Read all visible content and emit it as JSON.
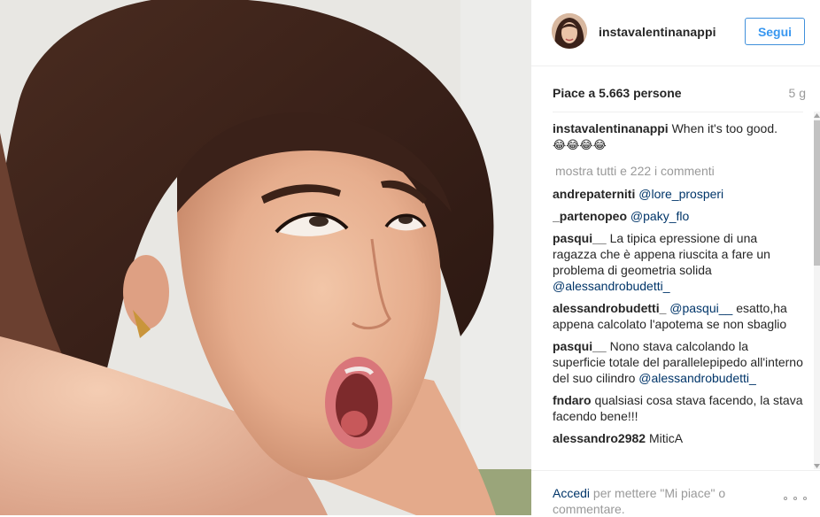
{
  "post": {
    "image_alt": "",
    "account_username": "instavalentinanappi",
    "follow_label": "Segui",
    "likes_text": "Piace a 5.663 persone",
    "time_ago": "5 g"
  },
  "caption": {
    "user": "instavalentinanappi",
    "text": "When it's too good.",
    "emoji": "😂😂😂😂"
  },
  "load_more_label": "mostra tutti e 222 i commenti",
  "comments": [
    {
      "user": "andrepaterniti",
      "mention": "@lore_prosperi",
      "text": "",
      "trailing_mention": ""
    },
    {
      "user": "_partenopeo",
      "mention": "@paky_flo",
      "text": "",
      "trailing_mention": ""
    },
    {
      "user": "pasqui__",
      "mention": "",
      "text": "La tipica epressione di una ragazza che è appena riuscita a fare un problema di geometria solida",
      "trailing_mention": "@alessandrobudetti_"
    },
    {
      "user": "alessandrobudetti_",
      "mention": "@pasqui__",
      "text": "esatto,ha appena calcolato l'apotema se non sbaglio",
      "trailing_mention": ""
    },
    {
      "user": "pasqui__",
      "mention": "",
      "text": "Nono stava calcolando la superficie totale del parallelepipedo all'interno del suo cilindro",
      "trailing_mention": "@alessandrobudetti_"
    },
    {
      "user": "fndaro",
      "mention": "",
      "text": "qualsiasi cosa stava facendo, la stava facendo bene!!!",
      "trailing_mention": ""
    },
    {
      "user": "alessandro2982",
      "mention": "",
      "text": "MiticA",
      "trailing_mention": ""
    }
  ],
  "footer": {
    "login_link": "Accedi",
    "login_suffix": "per mettere \"Mi piace\" o commentare."
  },
  "colors": {
    "link_blue": "#3897f0",
    "mention_dark_blue": "#003569",
    "muted_gray": "#999999",
    "text": "#262626"
  },
  "icons": {
    "more_options": "ellipsis-icon",
    "scroll_up": "arrow-up-icon",
    "scroll_down": "arrow-down-icon"
  }
}
